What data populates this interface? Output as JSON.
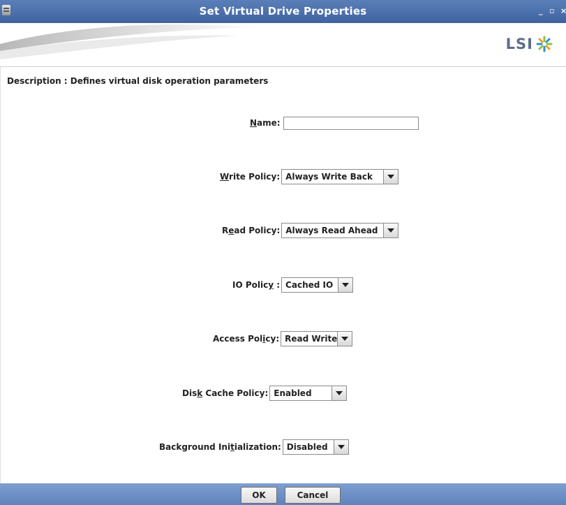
{
  "window": {
    "title": "Set Virtual Drive Properties",
    "minimize": "_",
    "maximize": "▫",
    "close": "×"
  },
  "banner": {
    "logo_text": "LSI"
  },
  "description": "Description : Defines virtual disk operation parameters",
  "fields": {
    "name": {
      "label_pre": "",
      "label_key": "N",
      "label_post": "ame:",
      "value": ""
    },
    "write": {
      "label_pre": "",
      "label_key": "W",
      "label_post": "rite Policy:",
      "value": "Always Write Back"
    },
    "read": {
      "label_pre": "R",
      "label_key": "e",
      "label_post": "ad Policy:",
      "value": "Always Read Ahead"
    },
    "io": {
      "label_pre": "IO Polic",
      "label_key": "y",
      "label_post": " :",
      "value": "Cached IO"
    },
    "access": {
      "label_pre": "Access Pol",
      "label_key": "i",
      "label_post": "cy:",
      "value": "Read Write"
    },
    "disk_cache": {
      "label_pre": "Dis",
      "label_key": "k",
      "label_post": " Cache Policy:",
      "value": "Enabled"
    },
    "background": {
      "label_pre": "Background Ini",
      "label_key": "t",
      "label_post": "ialization:",
      "value": "Disabled"
    }
  },
  "buttons": {
    "ok": "OK",
    "cancel": "Cancel"
  }
}
